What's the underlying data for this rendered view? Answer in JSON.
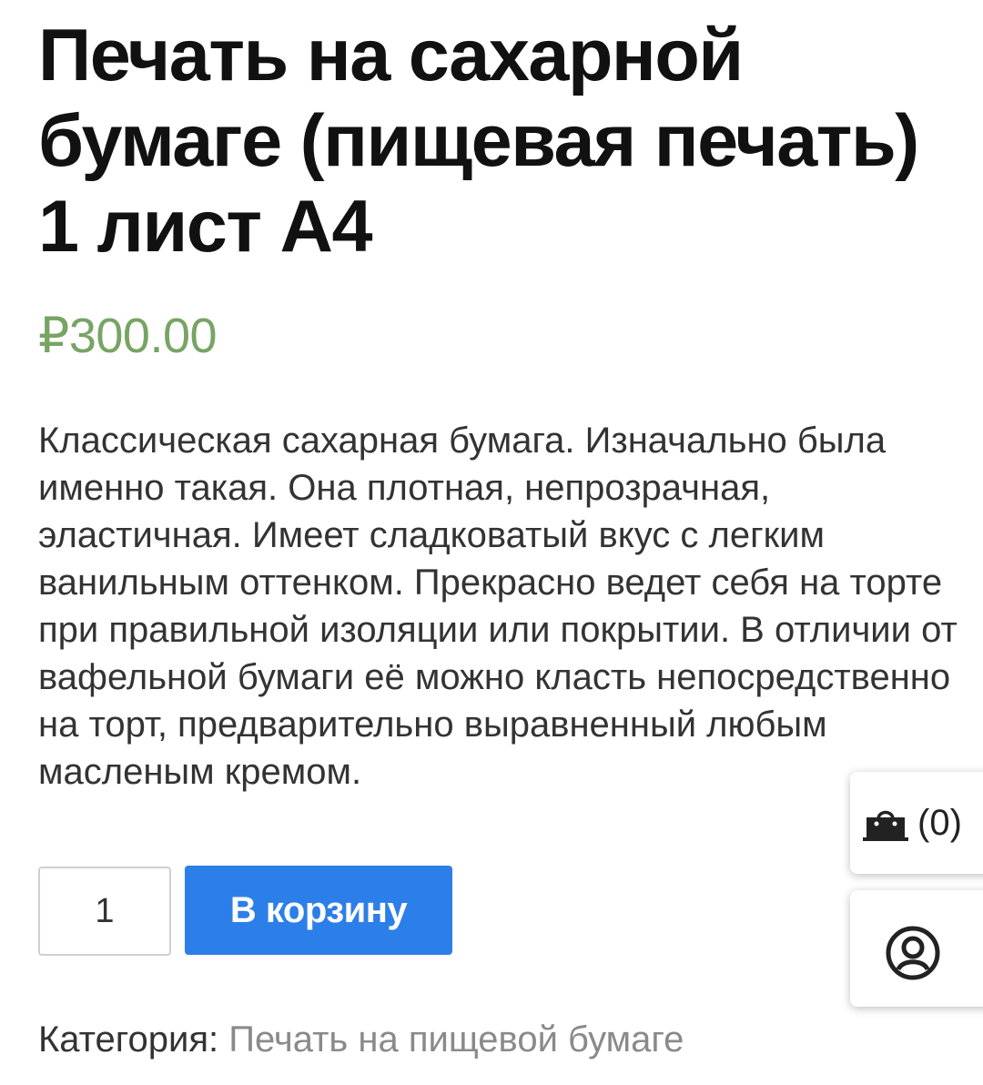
{
  "product": {
    "title": "Печать на сахарной бумаге (пищевая печать) 1 лист А4",
    "price": "₽300.00",
    "description": "Классическая сахарная бумага. Изначально была именно такая. Она плотная, непрозрачная, эластичная. Имеет сладковатый вкус с легким ванильным оттенком. Прекрасно ведет себя на торте при правильной изоляции или покрытии. В отличии от вафельной бумаги её можно класть непосредственно на торт, предварительно выравненный любым масленым кремом.",
    "quantity": "1",
    "add_to_cart_label": "В корзину",
    "category_label": "Категория:",
    "category_value": "Печать на пищевой бумаге"
  },
  "cart_widget": {
    "icon": "shopping-bag-icon",
    "count": "(0)"
  },
  "account_widget": {
    "icon": "user-icon"
  },
  "colors": {
    "price": "#77a464",
    "button": "#2c7fe8",
    "category_link": "#8a8a8a"
  }
}
